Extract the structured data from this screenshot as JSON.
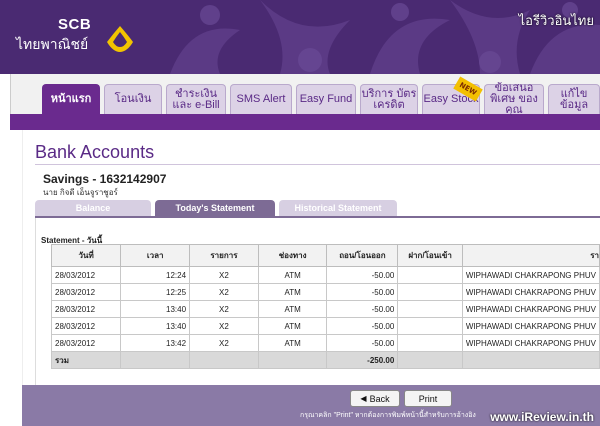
{
  "brand": {
    "name": "SCB",
    "thai_name": "ไทยพาณิชย์",
    "watermark_top": "ไอรีวิวอินไทย"
  },
  "nav": {
    "tabs": [
      {
        "label": "หน้าแรก",
        "active": true
      },
      {
        "label": "โอนเงิน"
      },
      {
        "label": "ชำระเงิน และ e-Bill"
      },
      {
        "label": "SMS Alert"
      },
      {
        "label": "Easy Fund"
      },
      {
        "label": "บริการ บัตรเครดิต"
      },
      {
        "label": "Easy Stock"
      },
      {
        "label": "ข้อเสนอพิเศษ ของคุณ"
      },
      {
        "label": "แก้ไขข้อมูล"
      }
    ],
    "new_badge": "NEW"
  },
  "page": {
    "title": "Bank Accounts",
    "account_name": "Savings - 1632142907",
    "account_holder": "นาย กิจดี เอ็นจูราชูอร์"
  },
  "subtabs": [
    {
      "label": "Balance"
    },
    {
      "label": "Today's Statement",
      "active": true
    },
    {
      "label": "Historical Statement"
    }
  ],
  "statement": {
    "label": "Statement - วันนี้",
    "columns": [
      "วันที่",
      "เวลา",
      "รายการ",
      "ช่องทาง",
      "ถอน/โอนออก",
      "ฝาก/โอนเข้า",
      "รา"
    ],
    "rows": [
      [
        "28/03/2012",
        "12:24",
        "X2",
        "ATM",
        "-50.00",
        "",
        "WIPHAWADI CHAKRAPONG PHUV"
      ],
      [
        "28/03/2012",
        "12:25",
        "X2",
        "ATM",
        "-50.00",
        "",
        "WIPHAWADI CHAKRAPONG PHUV"
      ],
      [
        "28/03/2012",
        "13:40",
        "X2",
        "ATM",
        "-50.00",
        "",
        "WIPHAWADI CHAKRAPONG PHUV"
      ],
      [
        "28/03/2012",
        "13:40",
        "X2",
        "ATM",
        "-50.00",
        "",
        "WIPHAWADI CHAKRAPONG PHUV"
      ],
      [
        "28/03/2012",
        "13:42",
        "X2",
        "ATM",
        "-50.00",
        "",
        "WIPHAWADI CHAKRAPONG PHUV"
      ]
    ],
    "total_label": "รวม",
    "total_value": "-250.00"
  },
  "footer": {
    "back_label": "Back",
    "print_label": "Print",
    "note": "กรุณาคลิก \"Print\" หากต้องการพิมพ์หน้านี้สำหรับการอ้างอิง",
    "watermark_bottom": "www.iReview.in.th"
  },
  "colors": {
    "header_purple": "#4a2a72",
    "nav_purple": "#6a2a8e",
    "footer_purple": "#8a7aa6"
  }
}
